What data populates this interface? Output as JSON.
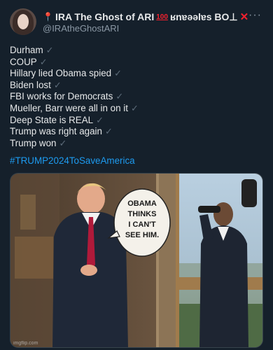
{
  "tweet": {
    "display_name": "IRA The Ghost of ARI",
    "name_suffix": "ʁnɐǝǝlɐs BO⊥",
    "hundred_badge": "100",
    "handle": "@IRAtheGhostARI",
    "more_label": "···",
    "lines": [
      "Durham",
      "COUP",
      "Hillary lied Obama spied",
      "Biden lost",
      "FBI works for Democrats",
      "Mueller, Barr were all in on it",
      "Deep State is REAL",
      "Trump was right again",
      "Trump won"
    ],
    "check_mark": "✓",
    "hashtag": "#TRUMP2024ToSaveAmerica",
    "media": {
      "bubble_lines": [
        "OBAMA",
        "THINKS",
        "I CAN'T",
        "SEE HIM."
      ],
      "watermark": "imgflip.com"
    }
  },
  "icons": {
    "pin": "pushpin-icon",
    "red_x": "red-x-icon",
    "hundred": "hundred-points-icon",
    "check": "check-mark-icon",
    "more": "more-options-icon"
  }
}
